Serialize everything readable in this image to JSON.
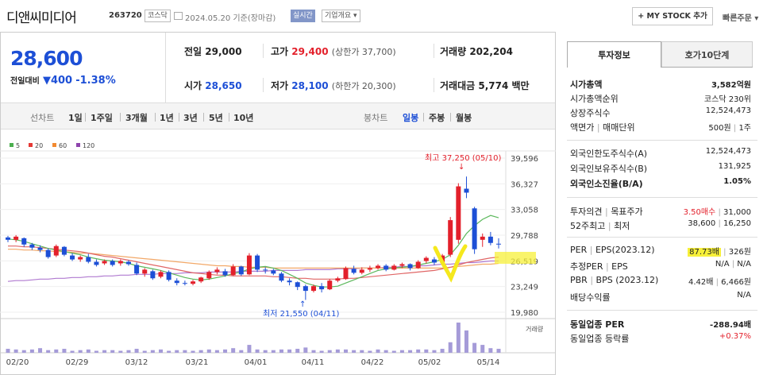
{
  "header": {
    "title": "디앤씨미디어",
    "code": "263720",
    "market": "코스닥",
    "date": "2024.05.20 기준(장마감)",
    "realtime": "실시간",
    "company": "기업개요 ▾",
    "mystock": "+ MY STOCK 추가",
    "quick": "빠른주문 ▾"
  },
  "quote": {
    "price": "28,600",
    "change_label": "전일대비",
    "change": "▼400",
    "change_pct": "-1.38%",
    "prev_label": "전일",
    "prev": "29,000",
    "high_label": "고가",
    "high": "29,400",
    "upper": "(상한가 37,700)",
    "volume_label": "거래량",
    "volume": "202,204",
    "open_label": "시가",
    "open": "28,650",
    "low_label": "저가",
    "low": "28,100",
    "lower": "(하한가 20,300)",
    "amount_label": "거래대금",
    "amount": "5,774 백만"
  },
  "periods": {
    "line": "선차트",
    "items": [
      "1일",
      "1주일",
      "3개월",
      "1년",
      "3년",
      "5년",
      "10년"
    ],
    "candle": "봉차트",
    "c_items": [
      "일봉",
      "주봉",
      "월봉"
    ]
  },
  "chart_data": {
    "type": "candlestick",
    "legend": [
      {
        "name": "5",
        "color": "#4caf50"
      },
      {
        "name": "20",
        "color": "#e53935"
      },
      {
        "name": "60",
        "color": "#f28a30"
      },
      {
        "name": "120",
        "color": "#8e44ad"
      }
    ],
    "yticks": [
      "39,596",
      "36,327",
      "33,058",
      "29,788",
      "26,519",
      "23,249",
      "19,980"
    ],
    "xticks": [
      "02/20",
      "02/29",
      "03/12",
      "03/21",
      "04/01",
      "04/11",
      "04/22",
      "05/02",
      "05/14"
    ],
    "max_label": "최고 37,250 (05/10)",
    "min_label": "최저 21,550 (04/11)",
    "volume_label": "거래량",
    "candles": [
      [
        29500,
        29700,
        28900,
        29200
      ],
      [
        29200,
        29800,
        28900,
        29600
      ],
      [
        29400,
        29500,
        28300,
        28600
      ],
      [
        28600,
        28800,
        27900,
        28200
      ],
      [
        28200,
        28500,
        27600,
        27900
      ],
      [
        27900,
        28100,
        26800,
        27000
      ],
      [
        27200,
        28600,
        27000,
        28400
      ],
      [
        28300,
        28400,
        27100,
        27300
      ],
      [
        27200,
        27500,
        26500,
        26700
      ],
      [
        26700,
        27200,
        26400,
        27000
      ],
      [
        27000,
        27400,
        26200,
        26400
      ],
      [
        26400,
        26700,
        25800,
        26000
      ],
      [
        26200,
        26700,
        26000,
        26500
      ],
      [
        26500,
        26700,
        25800,
        26000
      ],
      [
        26200,
        26700,
        25900,
        26500
      ],
      [
        26400,
        26600,
        25900,
        26100
      ],
      [
        26000,
        26300,
        24700,
        24900
      ],
      [
        24900,
        25600,
        24500,
        25400
      ],
      [
        25200,
        25400,
        24100,
        24300
      ],
      [
        24500,
        25300,
        24300,
        25100
      ],
      [
        25100,
        25300,
        23900,
        24100
      ],
      [
        24000,
        24300,
        23400,
        23700
      ],
      [
        23700,
        24000,
        23400,
        23600
      ],
      [
        23600,
        24100,
        23400,
        23900
      ],
      [
        23900,
        24500,
        23700,
        24400
      ],
      [
        24300,
        25300,
        24100,
        25100
      ],
      [
        25100,
        25700,
        24800,
        25400
      ],
      [
        25200,
        25500,
        24500,
        24700
      ],
      [
        24700,
        26100,
        24600,
        25800
      ],
      [
        25800,
        25900,
        24600,
        24800
      ],
      [
        24800,
        27500,
        24700,
        27200
      ],
      [
        27200,
        27400,
        25100,
        25400
      ],
      [
        25400,
        25700,
        24900,
        25300
      ],
      [
        25300,
        25500,
        24700,
        24900
      ],
      [
        24900,
        25100,
        23800,
        24000
      ],
      [
        24000,
        24300,
        23400,
        23800
      ],
      [
        23800,
        23900,
        22800,
        23200
      ],
      [
        23300,
        23500,
        21550,
        22700
      ],
      [
        22700,
        23500,
        22500,
        23300
      ],
      [
        23300,
        23700,
        22500,
        22900
      ],
      [
        22900,
        24200,
        22800,
        24000
      ],
      [
        24000,
        24500,
        23800,
        24300
      ],
      [
        24200,
        25800,
        24100,
        25600
      ],
      [
        25500,
        25900,
        24800,
        25000
      ],
      [
        25000,
        25700,
        24800,
        25400
      ],
      [
        25400,
        25900,
        25100,
        25600
      ],
      [
        25600,
        26100,
        25400,
        25900
      ],
      [
        25900,
        26100,
        25200,
        25400
      ],
      [
        25400,
        26100,
        25300,
        25900
      ],
      [
        25900,
        26300,
        25600,
        26100
      ],
      [
        26100,
        26200,
        25300,
        25600
      ],
      [
        25600,
        26600,
        25500,
        26400
      ],
      [
        26500,
        27100,
        26200,
        26900
      ],
      [
        26700,
        27000,
        26000,
        26300
      ],
      [
        26300,
        27400,
        26100,
        27200
      ],
      [
        27300,
        32100,
        27000,
        31700
      ],
      [
        29200,
        36400,
        28700,
        36000
      ],
      [
        35700,
        37250,
        34500,
        35200
      ],
      [
        33200,
        33400,
        27400,
        28000
      ],
      [
        29200,
        30000,
        28300,
        29600
      ],
      [
        29600,
        30200,
        28500,
        28800
      ],
      [
        28700,
        29400,
        28100,
        28600
      ]
    ],
    "ma5": [
      29300,
      29200,
      29000,
      28700,
      28400,
      28100,
      27900,
      27700,
      27500,
      27300,
      27000,
      26800,
      26600,
      26500,
      26400,
      26200,
      25900,
      25700,
      25500,
      25300,
      25000,
      24700,
      24400,
      24200,
      24100,
      24200,
      24400,
      24600,
      24900,
      25100,
      25500,
      25700,
      25800,
      25600,
      25300,
      24800,
      24300,
      23700,
      23400,
      23200,
      23200,
      23300,
      23700,
      24100,
      24500,
      24900,
      25300,
      25500,
      25600,
      25700,
      25800,
      26000,
      26200,
      26400,
      26700,
      27300,
      28500,
      30000,
      31000,
      31800,
      32300,
      32000
    ],
    "ma20": [
      28400,
      28400,
      28300,
      28300,
      28200,
      28100,
      28000,
      27900,
      27800,
      27700,
      27500,
      27300,
      27100,
      27000,
      26800,
      26600,
      26400,
      26200,
      26000,
      25800,
      25600,
      25400,
      25200,
      25000,
      24900,
      24800,
      24700,
      24700,
      24600,
      24600,
      24600,
      24600,
      24600,
      24500,
      24500,
      24400,
      24300,
      24300,
      24200,
      24200,
      24200,
      24200,
      24300,
      24300,
      24400,
      24500,
      24600,
      24700,
      24800,
      24900,
      25000,
      25100,
      25200,
      25300,
      25500,
      25700,
      26000,
      26300,
      26500,
      26700,
      26900,
      27000
    ],
    "ma60": [
      28000,
      28000,
      27900,
      27900,
      27800,
      27800,
      27700,
      27700,
      27600,
      27500,
      27500,
      27400,
      27300,
      27200,
      27100,
      27000,
      26900,
      26800,
      26700,
      26600,
      26500,
      26400,
      26300,
      26200,
      26100,
      26000,
      25900,
      25900,
      25800,
      25800,
      25700,
      25700,
      25700,
      25600,
      25600,
      25600,
      25600,
      25600,
      25600,
      25600,
      25600,
      25600,
      25600,
      25600,
      25600,
      25600,
      25600,
      25600,
      25600,
      25600,
      25600,
      25600,
      25600,
      25600,
      25600,
      25700,
      25800,
      25900,
      26000,
      26100,
      26100,
      26200
    ],
    "ma120": [
      23900,
      24000,
      24000,
      24100,
      24200,
      24200,
      24300,
      24300,
      24400,
      24400,
      24500,
      24500,
      24600,
      24600,
      24700,
      24700,
      24800,
      24800,
      24800,
      24900,
      24900,
      24900,
      25000,
      25000,
      25000,
      25100,
      25100,
      25100,
      25100,
      25200,
      25200,
      25200,
      25200,
      25300,
      25300,
      25300,
      25300,
      25400,
      25400,
      25400,
      25400,
      25500,
      25500,
      25500,
      25600,
      25600,
      25600,
      25700,
      25700,
      25800,
      25800,
      25900,
      25900,
      26000,
      26100,
      26100,
      26200,
      26300,
      26300,
      26400,
      26500,
      26500
    ],
    "volume": [
      6,
      5,
      4,
      5,
      7,
      4,
      5,
      6,
      3,
      4,
      5,
      3,
      4,
      4,
      3,
      4,
      6,
      3,
      4,
      5,
      3,
      4,
      4,
      3,
      4,
      5,
      4,
      5,
      7,
      4,
      12,
      5,
      4,
      4,
      5,
      5,
      6,
      8,
      4,
      3,
      4,
      5,
      5,
      4,
      4,
      3,
      5,
      4,
      3,
      4,
      4,
      5,
      5,
      4,
      6,
      16,
      46,
      34,
      15,
      12,
      7,
      6
    ]
  },
  "right": {
    "tab1": "투자정보",
    "tab2": "호가10단계",
    "rows": [
      {
        "k": "시가총액",
        "v": "3,582억원"
      },
      {
        "k": "시가총액순위",
        "v": "코스닥 230위"
      },
      {
        "k": "상장주식수",
        "v": "12,524,473"
      },
      {
        "k": "액면가",
        "k2": "매매단위",
        "v": "500원",
        "v2": "1주"
      },
      {
        "k": "외국인한도주식수(A)",
        "v": "12,524,473"
      },
      {
        "k": "외국인보유주식수(B)",
        "v": "131,925"
      },
      {
        "k": "외국인소진율(B/A)",
        "v": "1.05%"
      },
      {
        "k": "투자의견",
        "k2": "목표주가",
        "v": "3.50매수",
        "v2": "31,000"
      },
      {
        "k": "52주최고",
        "k2": "최저",
        "v": "38,600",
        "v2": "16,250"
      },
      {
        "k": "PER",
        "k2": "EPS(2023.12)",
        "v": "87.73배",
        "v2": "326원"
      },
      {
        "k": "추정PER",
        "k2": "EPS",
        "v": "N/A",
        "v2": "N/A"
      },
      {
        "k": "PBR",
        "k2": "BPS (2023.12)",
        "v": "4.42배",
        "v2": "6,466원"
      },
      {
        "k": "배당수익률",
        "v": "N/A"
      },
      {
        "k": "동일업종 PER",
        "v": "-288.94배"
      },
      {
        "k": "동일업종 등락률",
        "v": "+0.37%"
      }
    ]
  }
}
